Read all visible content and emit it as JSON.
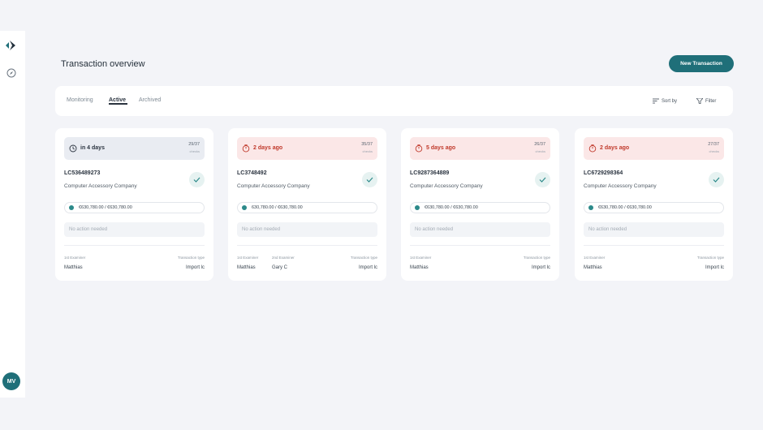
{
  "sidebar": {
    "avatar_initials": "MV"
  },
  "header": {
    "title": "Transaction overview",
    "new_button": "New Transaction"
  },
  "tabs": [
    {
      "label": "Monitoring",
      "active": false
    },
    {
      "label": "Active",
      "active": true
    },
    {
      "label": "Archived",
      "active": false
    }
  ],
  "toolbar": {
    "sort_label": "Sort by",
    "filter_label": "Filter"
  },
  "cards": [
    {
      "status": "in 4 days",
      "overdue": false,
      "count": "29/37",
      "count_sub": "checks",
      "lc": "LC536489273",
      "company": "Computer Accessory Company",
      "amount": "€630,780.00 / €630,780.00",
      "action": "No action needed",
      "examiner1_label": "1st Examiner",
      "examiner1": "Matthias",
      "examiner2_label": "",
      "examiner2": "",
      "type_label": "Transaction type",
      "type": "Import lc"
    },
    {
      "status": "2 days ago",
      "overdue": true,
      "count": "35/37",
      "count_sub": "checks",
      "lc": "LC3748492",
      "company": "Computer Accessory Company",
      "amount": "630,780.00 / €630,780.00",
      "action": "No action needed",
      "examiner1_label": "1st Examiner",
      "examiner1": "Matthias",
      "examiner2_label": "2nd Examiner",
      "examiner2": "Gary C",
      "type_label": "Transaction type",
      "type": "Import lc"
    },
    {
      "status": "5 days ago",
      "overdue": true,
      "count": "26/37",
      "count_sub": "checks",
      "lc": "LC9287364889",
      "company": "Computer Accessory Company",
      "amount": "€630,780.00 / €630,780.00",
      "action": "No action needed",
      "examiner1_label": "1st Examiner",
      "examiner1": "Matthias",
      "examiner2_label": "",
      "examiner2": "",
      "type_label": "Transaction type",
      "type": "Import lc"
    },
    {
      "status": "2 days ago",
      "overdue": true,
      "count": "27/37",
      "count_sub": "checks",
      "lc": "LC6729298364",
      "company": "Computer Accessory Company",
      "amount": "€630,780.00 / €630,780.00",
      "action": "No action needed",
      "examiner1_label": "1st Examiner",
      "examiner1": "Matthias",
      "examiner2_label": "",
      "examiner2": "",
      "type_label": "Transaction type",
      "type": "Import lc"
    }
  ],
  "colors": {
    "accent": "#1f6f79",
    "overdue_bg": "#fbe7e7",
    "overdue_text": "#c0392b",
    "neutral_bg": "#e9ecf2"
  }
}
